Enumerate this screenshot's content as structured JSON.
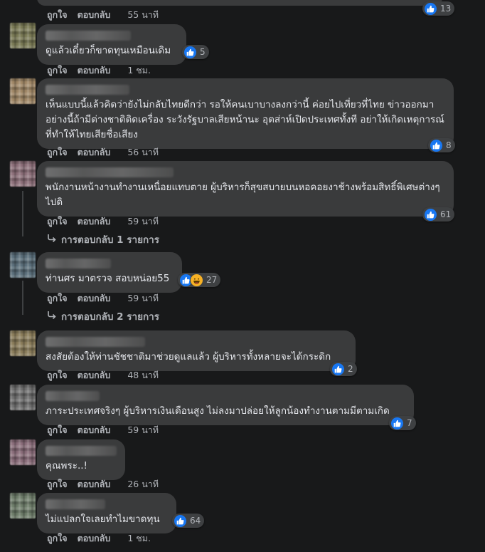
{
  "actions": {
    "like": "ถูกใจ",
    "reply": "ตอบกลับ"
  },
  "comments": [
    {
      "text": "",
      "time": "55 นาที",
      "reactions": "13",
      "has_haha": false
    },
    {
      "text": "ดูแล้วเดี๋ยวก็ขาดทุนเหมือนเดิม",
      "time": "1 ชม.",
      "reactions": "5",
      "has_haha": false
    },
    {
      "text": "เห็นแบบนี้แล้วคิดว่ายังไม่กลับไทยดีกว่า รอให้คนเบาบางลงกว่านี้ ค่อยไปเที่ยวที่ไทย ข่าวออกมาอย่างนี้ถ้ามีต่างชาติติดเครื่อง ระวังรัฐบาลเสียหน้านะ อุตส่าห์เปิดประเทศทั้งที อย่าให้เกิดเหตุการณ์ที่ทำให้ไทยเสียชื่อเสียง",
      "time": "56 นาที",
      "reactions": "8",
      "has_haha": false
    },
    {
      "text": "พนักงานหน้างานทำงานเหนื่อยแทบตาย ผู้บริหารก็สุขสบายบนหอคอยงาช้างพร้อมสิทธิ์พิเศษต่างๆไปดิ",
      "time": "59 นาที",
      "reactions": "61",
      "has_haha": false,
      "replies_label": "การตอบกลับ 1 รายการ"
    },
    {
      "text": "ท่านศร มาตรวจ สอบหน่อย55",
      "time": "59 นาที",
      "reactions": "27",
      "has_haha": true,
      "replies_label": "การตอบกลับ 2 รายการ"
    },
    {
      "text": "สงสัยต้องให้ท่านชัชชาติมาช่วยดูแลแล้ว ผู้บริหารทั้งหลายจะได้กระดิก",
      "time": "48 นาที",
      "reactions": "2",
      "has_haha": false
    },
    {
      "text": "ภาระประเทศจริงๆ ผู้บริหารเงินเดือนสูง ไม่ลงมาปล่อยให้ลูกน้องทำงานตามมีตามเกิด",
      "time": "59 นาที",
      "reactions": "7",
      "has_haha": false
    },
    {
      "text": "คุณพระ..!",
      "time": "26 นาที",
      "reactions": "",
      "has_haha": false
    },
    {
      "text": "ไม่แปลกใจเลยทำไมขาดทุน",
      "time": "1 ชม.",
      "reactions": "64",
      "has_haha": false
    }
  ],
  "colors": {
    "background": "#18191a",
    "bubble": "#3a3b3c",
    "like_blue": "#1877f2",
    "secondary_text": "#b0b3b8"
  },
  "icons": {
    "like": "thumbs-up-icon",
    "haha": "laughing-face-icon",
    "reply_arrow": "reply-arrow-icon"
  }
}
